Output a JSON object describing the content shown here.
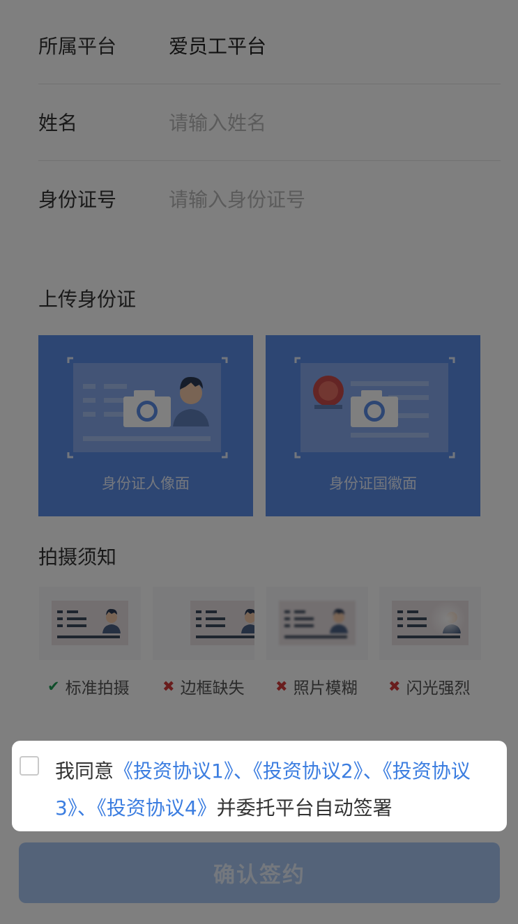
{
  "form": {
    "platform": {
      "label": "所属平台",
      "value": "爱员工平台"
    },
    "name": {
      "label": "姓名",
      "placeholder": "请输入姓名"
    },
    "id_number": {
      "label": "身份证号",
      "placeholder": "请输入身份证号"
    }
  },
  "upload": {
    "title": "上传身份证",
    "front_caption": "身份证人像面",
    "back_caption": "身份证国徽面"
  },
  "tips": {
    "title": "拍摄须知",
    "items": [
      {
        "label": "标准拍摄",
        "status": "ok"
      },
      {
        "label": "边框缺失",
        "status": "bad"
      },
      {
        "label": "照片模糊",
        "status": "bad"
      },
      {
        "label": "闪光强烈",
        "status": "bad"
      }
    ]
  },
  "agreement": {
    "prefix": "我同意",
    "link1": "《投资协议1》",
    "sep1": "、",
    "link2": "《投资协议2》",
    "sep2": "、",
    "link3": "《投资协议3》",
    "sep3": "、",
    "link4": "《投资协议4》",
    "suffix": "并委托平台自动签署"
  },
  "confirm_button": "确认签约",
  "colors": {
    "accent": "#3b7de0",
    "card": "#5a8ce6",
    "ok": "#1f9d55",
    "bad": "#d33b3b"
  },
  "icons": {
    "check": "✔",
    "cross": "✖"
  }
}
